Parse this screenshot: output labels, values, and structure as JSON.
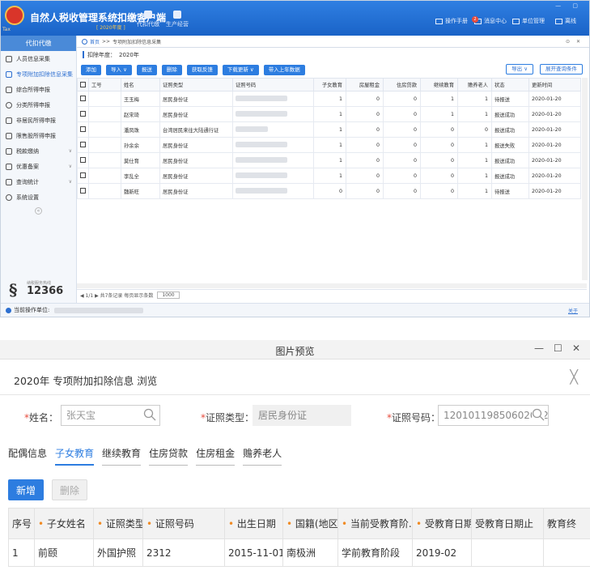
{
  "win1": {
    "title": "自然人税收管理系统扣缴客户端",
    "logo_sub": "Tax",
    "menu": [
      {
        "label": "代扣代缴"
      },
      {
        "label": "生产经营"
      }
    ],
    "sub_badge": "[ 2020年度 ]",
    "right_menu": [
      "操作手册",
      "消息中心",
      "单位管理",
      "离线"
    ],
    "msg_count": "2",
    "window_controls": "— ▢",
    "sidebar": {
      "header": "代扣代缴",
      "items": [
        {
          "label": "人员信息采集"
        },
        {
          "label": "专项附加扣除信息采集"
        },
        {
          "label": "综合所得申报"
        },
        {
          "label": "分类所得申报"
        },
        {
          "label": "非居民所得申报"
        },
        {
          "label": "限售股所得申报"
        },
        {
          "label": "税款缴纳"
        },
        {
          "label": "优惠备案"
        },
        {
          "label": "查询统计"
        },
        {
          "label": "系统设置"
        }
      ],
      "hotline_label": "纳税服务热线",
      "hotline_number": "12366"
    },
    "breadcrumb": {
      "home": "首页",
      "sep": ">>",
      "current": "专项附加扣除信息采集",
      "tab_controls": "⊙ ✕"
    },
    "year": {
      "label": "扣除年度：",
      "value": "2020年"
    },
    "toolbar": {
      "add": "添加",
      "import": "导入",
      "report": "报送",
      "delete": "删除",
      "feedback": "获取反馈",
      "download": "下载更新",
      "bring_last": "带入上年数据",
      "export": "导出",
      "expand_query": "展开查询条件"
    },
    "table": {
      "headers": [
        "工号",
        "姓名",
        "证照类型",
        "证照号码",
        "子女教育",
        "房屋租金",
        "住房贷款",
        "继续教育",
        "赡养老人",
        "状态",
        "更新时间"
      ],
      "rows": [
        {
          "name": "王玉梅",
          "id_type": "居民身份证",
          "child": "1",
          "rent": "0",
          "loan": "0",
          "cont": "1",
          "elder": "1",
          "status": "待报送",
          "time": "2020-01-20"
        },
        {
          "name": "赵宋琦",
          "id_type": "居民身份证",
          "child": "1",
          "rent": "0",
          "loan": "0",
          "cont": "1",
          "elder": "1",
          "status": "报送成功",
          "time": "2020-01-20"
        },
        {
          "name": "潘凤珠",
          "id_type": "台湾居民来往大陆通行证",
          "child": "1",
          "rent": "0",
          "loan": "0",
          "cont": "0",
          "elder": "0",
          "status": "报送成功",
          "time": "2020-01-20"
        },
        {
          "name": "孙余余",
          "id_type": "居民身份证",
          "child": "1",
          "rent": "0",
          "loan": "0",
          "cont": "0",
          "elder": "1",
          "status": "报送失败",
          "time": "2020-01-20"
        },
        {
          "name": "莫仕育",
          "id_type": "居民身份证",
          "child": "1",
          "rent": "0",
          "loan": "0",
          "cont": "0",
          "elder": "1",
          "status": "报送成功",
          "time": "2020-01-20"
        },
        {
          "name": "李乱全",
          "id_type": "居民身份证",
          "child": "1",
          "rent": "0",
          "loan": "0",
          "cont": "0",
          "elder": "1",
          "status": "报送成功",
          "time": "2020-01-20"
        },
        {
          "name": "魏新旺",
          "id_type": "居民身份证",
          "child": "0",
          "rent": "0",
          "loan": "0",
          "cont": "0",
          "elder": "1",
          "status": "待报送",
          "time": "2020-01-20"
        }
      ]
    },
    "pager": {
      "text": "◀ 1/1 ▶ 共7条记录 每页显示条数",
      "size": "1000"
    },
    "status_bar": {
      "label": "当前操作单位:",
      "about": "关于"
    }
  },
  "win2": {
    "title": "图片预览",
    "ctl_min": "—",
    "ctl_max": "☐",
    "ctl_close": "✕",
    "header": "2020年 专项附加扣除信息 浏览",
    "close": "╳",
    "fields": {
      "name_label": "姓名：",
      "name_value": "张天宝",
      "idtype_label": "证照类型：",
      "idtype_value": "居民身份证",
      "idno_label": "证照号码：",
      "idno_value": "12010119850602002"
    },
    "tabs": [
      "配偶信息",
      "子女教育",
      "继续教育",
      "住房贷款",
      "住房租金",
      "赡养老人"
    ],
    "buttons": {
      "add": "新增",
      "delete": "删除"
    },
    "table": {
      "headers": [
        "序号",
        "子女姓名",
        "证照类型",
        "证照号码",
        "出生日期",
        "国籍(地区)",
        "当前受教育阶...",
        "受教育日期起",
        "受教育日期止",
        "教育终"
      ],
      "row": {
        "seq": "1",
        "name": "前颐",
        "id_type": "外国护照",
        "id_no": "2312",
        "birth": "2015-11-01",
        "nationality": "南极洲",
        "stage": "学前教育阶段",
        "start": "2019-02",
        "end": "",
        "edu_end": ""
      }
    }
  }
}
